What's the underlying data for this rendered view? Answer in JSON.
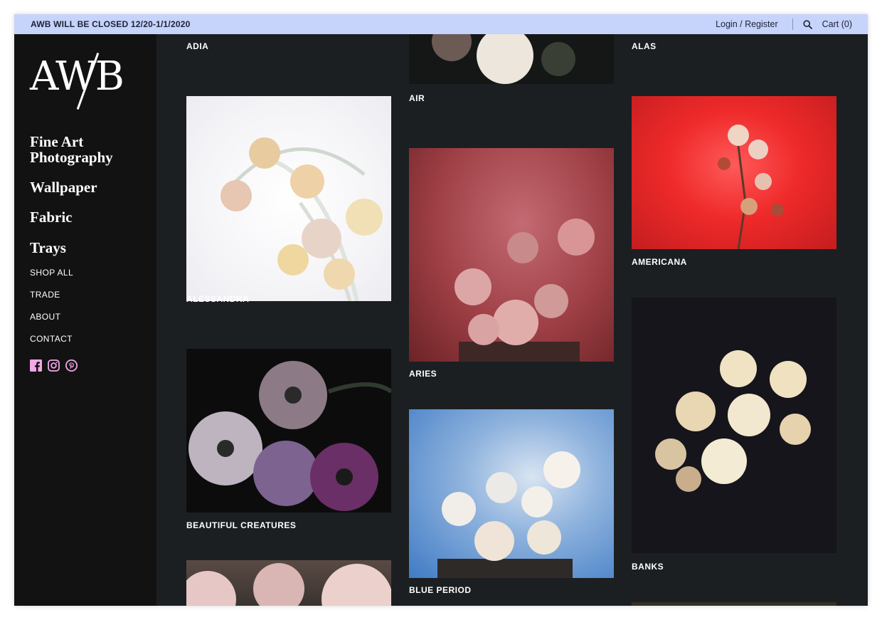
{
  "topbar": {
    "announcement": "AWB WILL BE CLOSED 12/20-1/1/2020",
    "login_register": "Login / Register",
    "cart": "Cart (0)",
    "search_icon": "search-icon"
  },
  "brand": {
    "logo": "AWB"
  },
  "nav": {
    "main": [
      {
        "label": "Fine Art Photography"
      },
      {
        "label": "Wallpaper"
      },
      {
        "label": "Fabric"
      },
      {
        "label": "Trays"
      }
    ],
    "sub": [
      {
        "label": "SHOP ALL"
      },
      {
        "label": "TRADE"
      },
      {
        "label": "ABOUT"
      },
      {
        "label": "CONTACT"
      }
    ],
    "social": [
      "facebook-icon",
      "instagram-icon",
      "pinterest-icon"
    ]
  },
  "products": [
    {
      "name": "ADIA"
    },
    {
      "name": "AIR"
    },
    {
      "name": "ALAS"
    },
    {
      "name": "ALESSANDRA"
    },
    {
      "name": "ARIES"
    },
    {
      "name": "AMERICANA"
    },
    {
      "name": "BEAUTIFUL CREATURES"
    },
    {
      "name": "BLUE PERIOD"
    },
    {
      "name": "BANKS"
    }
  ],
  "colors": {
    "announcement_bg": "#c6d3fb",
    "sidebar_bg": "#121212",
    "main_bg": "#1c1f22",
    "social_accent": "#f2a7e6"
  }
}
